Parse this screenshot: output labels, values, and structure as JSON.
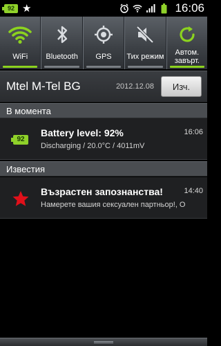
{
  "status_bar": {
    "battery_level": "92",
    "time": "16:06",
    "icons": [
      "star-icon",
      "alarm-icon",
      "wifi-icon",
      "signal-icon",
      "battery-icon"
    ]
  },
  "toggles": [
    {
      "label": "WiFi",
      "icon": "wifi-icon",
      "on": true
    },
    {
      "label": "Bluetooth",
      "icon": "bluetooth-icon",
      "on": false
    },
    {
      "label": "GPS",
      "icon": "gps-icon",
      "on": false
    },
    {
      "label": "Тих режим",
      "icon": "mute-icon",
      "on": false
    },
    {
      "label": "Автом. завърт.",
      "icon": "rotate-icon",
      "on": true
    }
  ],
  "carrier": {
    "name": "Mtel M-Tel BG",
    "date": "2012.12.08",
    "clear_label": "Изч."
  },
  "sections": {
    "ongoing": "В момента",
    "notifications": "Известия"
  },
  "notifications": [
    {
      "icon": "battery-icon",
      "icon_text": "92",
      "title": "Battery level: 92%",
      "time": "16:06",
      "text": "Discharging / 20.0°C / 4011mV"
    },
    {
      "icon": "star-icon",
      "title": "Възрастен запознанства!",
      "time": "14:40",
      "text": "Намерете вашия сексуален партньор!, О"
    }
  ],
  "colors": {
    "accent_green": "#8cd31f",
    "star_red": "#e0101a"
  }
}
